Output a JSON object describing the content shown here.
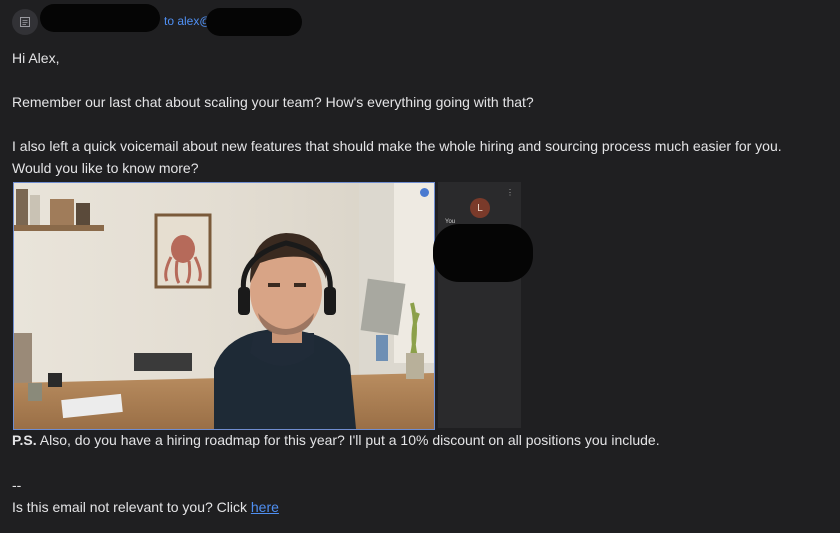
{
  "header": {
    "to_label": "to alex@"
  },
  "email": {
    "greeting": "Hi Alex,",
    "para1": "Remember our last chat about scaling your team? How's everything going with that?",
    "para2_line1": "I also left a quick voicemail about new features that should make the whole hiring and sourcing process much easier for you.",
    "para2_line2": "Would you like to know more?",
    "ps_label": "P.S.",
    "ps_text": " Also, do you have a hiring roadmap for this year? I'll put a 10% discount on all positions you include.",
    "sig_dash": "--",
    "unsub_text": "Is this email not relevant to you? Click ",
    "unsub_link": "here"
  },
  "video": {
    "tile_avatar_letter": "L",
    "tile_label": "You"
  },
  "colors": {
    "background": "#1f1f21",
    "text": "#e4e4e6",
    "link": "#4f8ff2"
  }
}
